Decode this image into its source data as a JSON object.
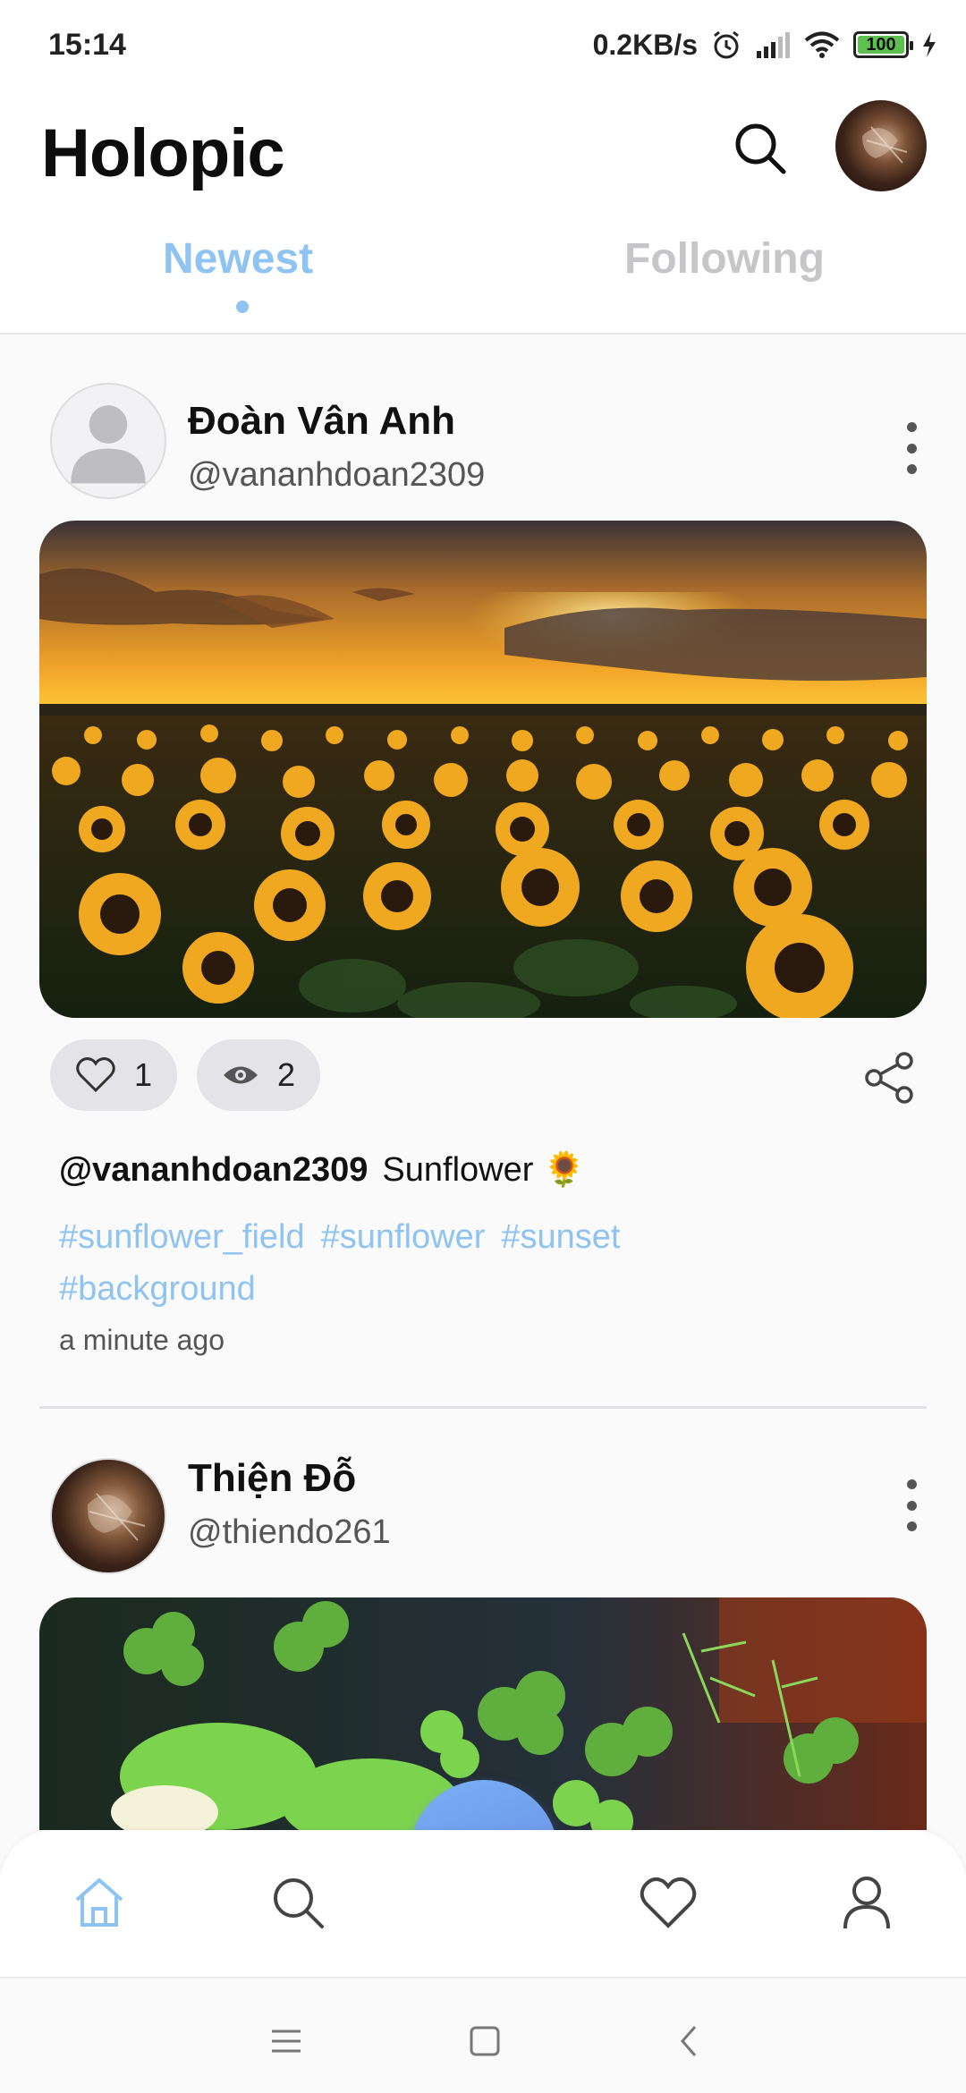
{
  "status_bar": {
    "time": "15:14",
    "net_speed": "0.2KB/s",
    "battery": "100"
  },
  "header": {
    "title": "Holopic"
  },
  "tabs": [
    {
      "label": "Newest",
      "active": true
    },
    {
      "label": "Following",
      "active": false
    }
  ],
  "posts": [
    {
      "name": "Đoàn Vân Anh",
      "handle": "@vananhdoan2309",
      "likes": "1",
      "views": "2",
      "caption_user": "@vananhdoan2309",
      "caption_text": "Sunflower 🌻",
      "tags": [
        "#sunflower_field",
        "#sunflower",
        "#sunset",
        "#background"
      ],
      "time_ago": "a minute ago"
    },
    {
      "name": "Thiện Đỗ",
      "handle": "@thiendo261"
    }
  ],
  "colors": {
    "accent": "#8ec3f2",
    "fab_start": "#78b0f5",
    "fab_end": "#6787e2",
    "inactive_tab": "#c6c6c8",
    "pill_bg": "#e4e4e8"
  },
  "bottom_nav": {
    "items": [
      "home-icon",
      "search-icon",
      "add-icon",
      "heart-icon",
      "profile-icon"
    ],
    "active": "home-icon"
  }
}
